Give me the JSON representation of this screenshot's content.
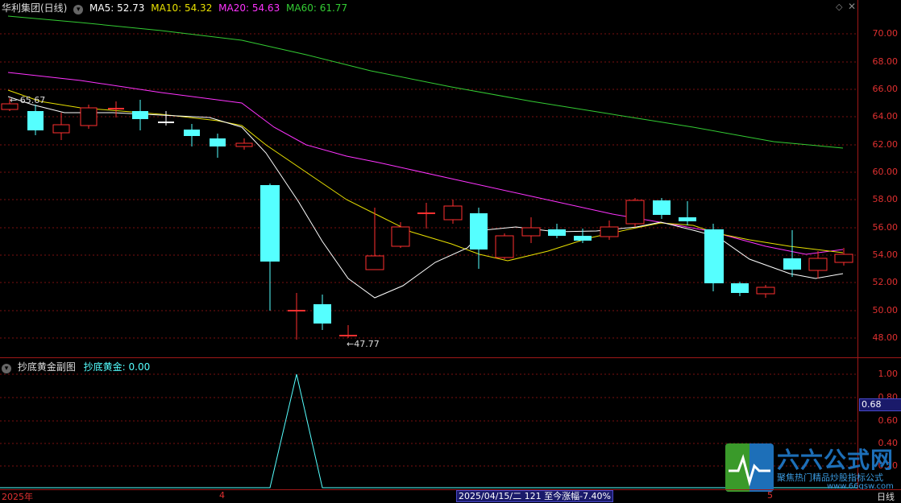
{
  "main": {
    "title": "华利集团(日线)",
    "ma5": "MA5: 52.73",
    "ma10": "MA10: 54.32",
    "ma20": "MA20: 54.63",
    "ma60": "MA60: 61.77",
    "high_label": "← 65.67",
    "low_label": "←47.77",
    "yticks": [
      "70.00",
      "68.00",
      "66.00",
      "64.00",
      "62.00",
      "60.00",
      "58.00",
      "56.00",
      "54.00",
      "52.00",
      "50.00",
      "48.00"
    ],
    "colors": {
      "ma5": "#ffffff",
      "ma10": "#e8e000",
      "ma20": "#ff33ff",
      "ma60": "#33cc33",
      "up": "#ff3030",
      "down": "#55ffff"
    }
  },
  "sub": {
    "title": "抄底黄金副图",
    "indicator": "抄底黄金: 0.00",
    "cursor_value": "0.68",
    "yticks": [
      "1.00",
      "0.80",
      "0.60",
      "0.40",
      "0.20"
    ]
  },
  "xaxis": {
    "year": "2025年",
    "month4": "4",
    "month5": "5",
    "status": "2025/04/15/二  121  至今涨幅-7.40%",
    "period": "日线"
  },
  "watermark": {
    "brand": "六六公式网",
    "slogan": "聚焦热门精品炒股指标公式",
    "url": "www.66gsw.com"
  }
}
